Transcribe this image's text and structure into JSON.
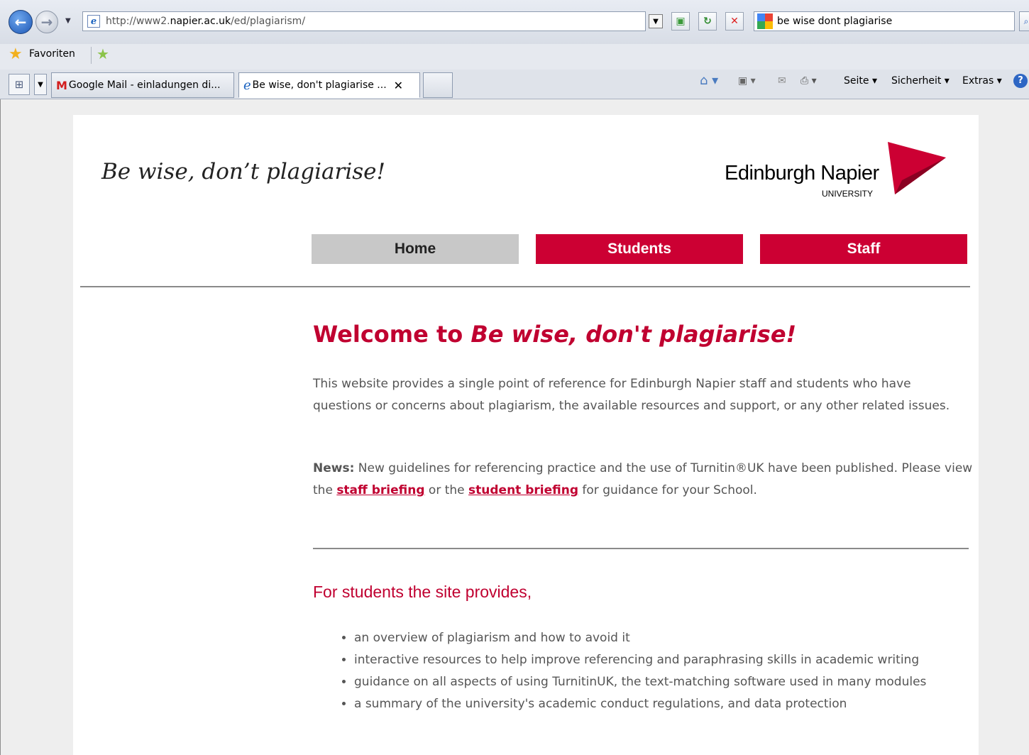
{
  "browser": {
    "address_prefix": "http://www2.",
    "address_host": "napier.ac.uk",
    "address_path": "/ed/plagiarism/",
    "search_query": "be wise dont plagiarise",
    "favorites_label": "Favoriten",
    "tabs": [
      {
        "label": "Google Mail - einladungen di..."
      },
      {
        "label": "Be wise, don't plagiarise ..."
      }
    ],
    "command_bar": {
      "page": "Seite ▾",
      "safety": "Sicherheit ▾",
      "tools": "Extras ▾"
    }
  },
  "site": {
    "title": "Be wise, don’t plagiarise!",
    "logo_name": "Edinburgh Napier",
    "logo_sub": "UNIVERSITY",
    "logo_color": "#cc0033",
    "nav": [
      {
        "label": "Home"
      },
      {
        "label": "Students"
      },
      {
        "label": "Staff"
      }
    ]
  },
  "main": {
    "welcome_prefix": "Welcome to ",
    "welcome_emph": "Be wise, don't plagiarise!",
    "intro": "This website provides a single point of reference for Edinburgh Napier staff and students who have questions or concerns about plagiarism, the available resources and support, or any other related issues.",
    "news_label": "News:",
    "news_text_1": " New guidelines for referencing practice and the use of Turnitin®UK have been published. Please view the ",
    "staff_link": "staff briefing",
    "news_text_2": " or the ",
    "student_link": "student briefing",
    "news_text_3": " for guidance for your School.",
    "students_heading": "For students the site provides,",
    "student_items": [
      "an overview of plagiarism and how to avoid it",
      "interactive resources to help improve referencing and paraphrasing skills in academic writing",
      "guidance on all aspects of using TurnitinUK, the text-matching software used in many modules",
      "a summary of the university's academic conduct regulations, and data protection"
    ]
  }
}
